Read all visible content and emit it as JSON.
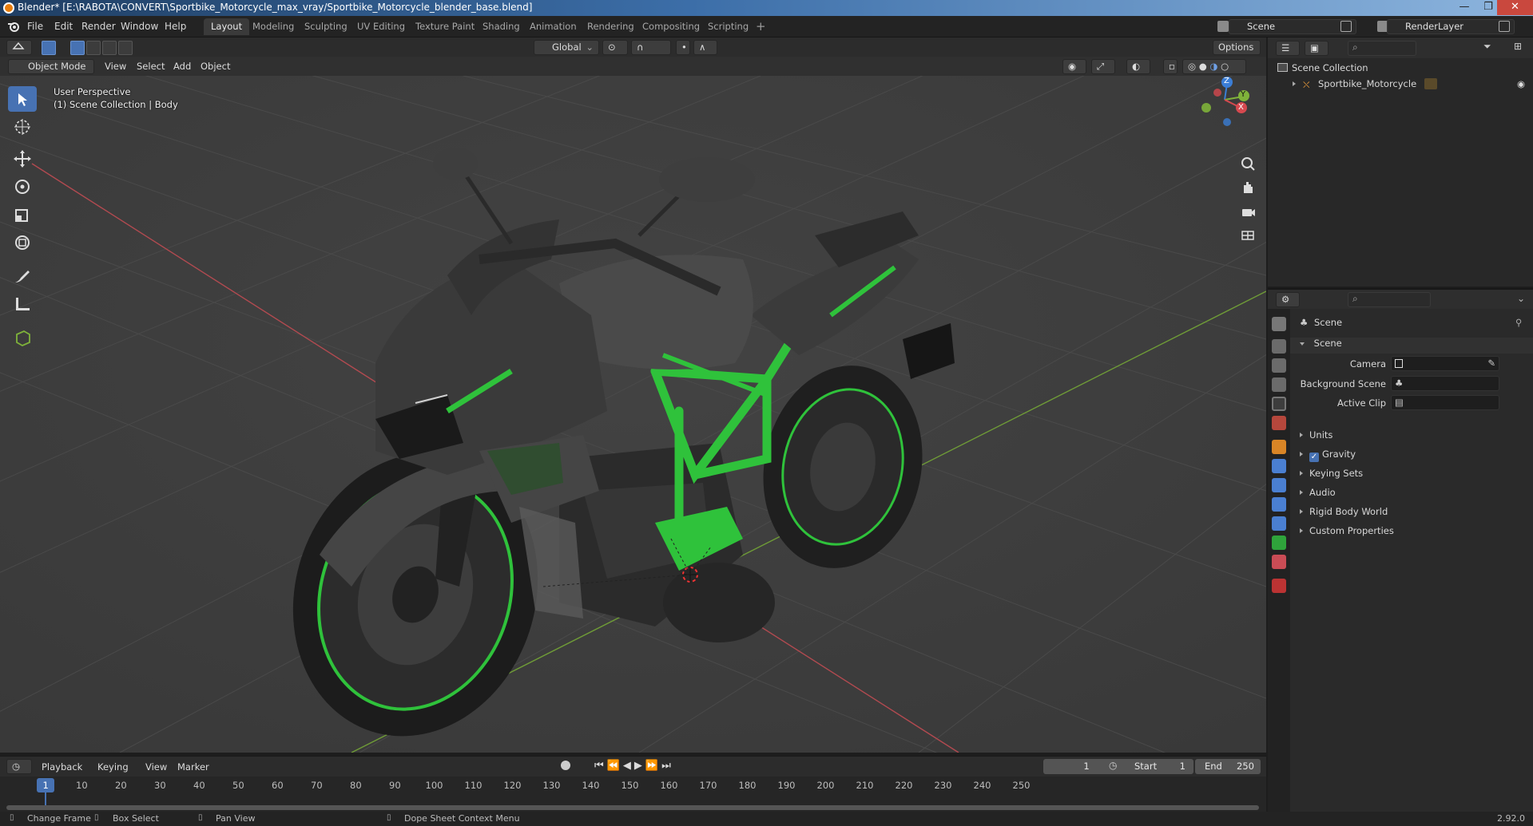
{
  "window": {
    "title": "Blender* [E:\\RABOTA\\CONVERT\\Sportbike_Motorcycle_max_vray/Sportbike_Motorcycle_blender_base.blend]",
    "minimize": "—",
    "maximize": "❐",
    "close": "✕"
  },
  "menu": {
    "items": [
      "File",
      "Edit",
      "Render",
      "Window",
      "Help"
    ]
  },
  "workspaces": {
    "tabs": [
      "Layout",
      "Modeling",
      "Sculpting",
      "UV Editing",
      "Texture Paint",
      "Shading",
      "Animation",
      "Rendering",
      "Compositing",
      "Scripting"
    ],
    "active": "Layout",
    "add": "+"
  },
  "scene_selector": {
    "value": "Scene"
  },
  "render_layer_selector": {
    "value": "RenderLayer"
  },
  "viewport_header": {
    "transform_orientation": "Global",
    "options": "Options",
    "mode": "Object Mode",
    "menus": [
      "View",
      "Select",
      "Add",
      "Object"
    ]
  },
  "viewport": {
    "perspective": "User Perspective",
    "collection_info": "(1) Scene Collection | Body",
    "gizmo_axes": {
      "x": "X",
      "y": "Y",
      "z": "Z"
    }
  },
  "timeline": {
    "menus": [
      "Playback",
      "Keying",
      "View",
      "Marker"
    ],
    "current_frame": "1",
    "start_label": "Start",
    "start": "1",
    "end_label": "End",
    "end": "250",
    "ruler": [
      "1",
      "10",
      "20",
      "30",
      "40",
      "50",
      "60",
      "70",
      "80",
      "90",
      "100",
      "110",
      "120",
      "130",
      "140",
      "150",
      "160",
      "170",
      "180",
      "190",
      "200",
      "210",
      "220",
      "230",
      "240",
      "250"
    ]
  },
  "statusbar": {
    "items": [
      "Change Frame",
      "Box Select",
      "Pan View",
      "Dope Sheet Context Menu"
    ],
    "version": "2.92.0"
  },
  "outliner": {
    "root": "Scene Collection",
    "children": [
      {
        "label": "Sportbike_Motorcycle"
      }
    ]
  },
  "properties": {
    "context": "Scene",
    "panel_title": "Scene",
    "fields": [
      {
        "label": "Camera",
        "value": ""
      },
      {
        "label": "Background Scene",
        "value": ""
      },
      {
        "label": "Active Clip",
        "value": ""
      }
    ],
    "subpanels": [
      "Units",
      "Gravity",
      "Keying Sets",
      "Audio",
      "Rigid Body World",
      "Custom Properties"
    ],
    "gravity_checked": true
  },
  "colors": {
    "accent": "#4772b3",
    "axis_x": "#d6494f",
    "axis_y": "#7fb33a",
    "axis_z": "#3b7ed6",
    "bike_green": "#2fc23b"
  }
}
